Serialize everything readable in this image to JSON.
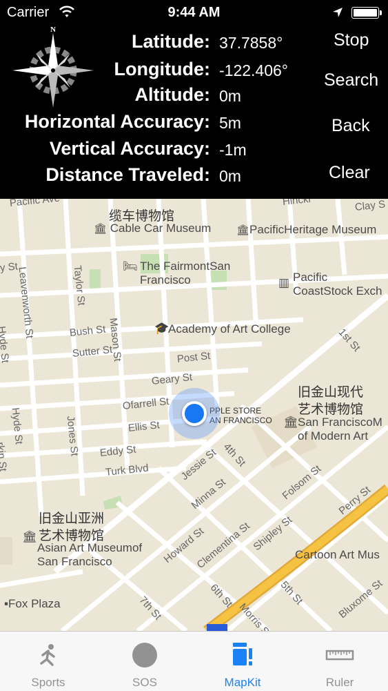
{
  "status_bar": {
    "carrier": "Carrier",
    "time": "9:44 AM"
  },
  "info": {
    "latitude_label": "Latitude:",
    "latitude_value": "37.7858°",
    "longitude_label": "Longitude:",
    "longitude_value": "-122.406°",
    "altitude_label": "Altitude:",
    "altitude_value": "0m",
    "horizontal_accuracy_label": "Horizontal Accuracy:",
    "horizontal_accuracy_value": "5m",
    "vertical_accuracy_label": "Vertical Accuracy:",
    "vertical_accuracy_value": "-1m",
    "distance_traveled_label": "Distance Traveled:",
    "distance_traveled_value": "0m"
  },
  "buttons": {
    "stop": "Stop",
    "search": "Search",
    "back": "Back",
    "clear": "Clear"
  },
  "compass": {
    "north": "N"
  },
  "map": {
    "pois": {
      "cable_car_cn": "缆车博物馆",
      "cable_car": "Cable Car Museum",
      "pacific_heritage": "PacificHeritage Museum",
      "fairmont_1": "The FairmontSan",
      "fairmont_2": "Francisco",
      "pacific_coast_1": "Pacific",
      "pacific_coast_2": "CoastStock Exch",
      "academy": "Academy of Art College",
      "sfmoma_cn_1": "旧金山现代",
      "sfmoma_cn_2": "艺术博物馆",
      "sfmoma_1": "San FranciscoM",
      "sfmoma_2": "of Modern Art",
      "apple_1": "PPLE STORE",
      "apple_2": "AN FRANCISCO",
      "asian_cn_1": "旧金山亚洲",
      "asian_cn_2": "艺术博物馆",
      "asian_1": "Asian Art Museumof",
      "asian_2": "San Francisco",
      "cartoon": "Cartoon Art Mus",
      "fox_plaza": "Fox Plaza"
    },
    "streets": {
      "pacific_ave": "Pacific Ave",
      "clay": "Clay S",
      "leavenworth": "Leavenworth St",
      "taylor": "Taylor St",
      "hyde_1": "Hyde St",
      "hyde_2": "Hyde St",
      "bush": "Bush St",
      "sutter": "Sutter St",
      "mason": "Mason St",
      "post": "Post St",
      "geary": "Geary St",
      "ofarrell": "Ofarrell St",
      "ellis": "Ellis St",
      "eddy": "Eddy St",
      "turk": "Turk Blvd",
      "jones": "Jones St",
      "jessie": "Jessie St",
      "fourth": "4th St",
      "first": "1st St",
      "minna": "Minna St",
      "folsom": "Folsom St",
      "howard": "Howard St",
      "clementina": "Clementina St",
      "shipley": "Shipley St",
      "perry": "Perry St",
      "fifth": "5th St",
      "sixth": "6th St",
      "seventh": "7th St",
      "morris": "Morris St",
      "bluxome": "Bluxome St",
      "larkin": "rkin St",
      "washington": "Hinckl",
      "fy": "y St"
    }
  },
  "tabs": [
    {
      "label": "Sports",
      "icon": "runner-icon",
      "active": false
    },
    {
      "label": "SOS",
      "icon": "circle-icon",
      "active": false
    },
    {
      "label": "MapKit",
      "icon": "map-icon",
      "active": true
    },
    {
      "label": "Ruler",
      "icon": "ruler-icon",
      "active": false
    }
  ],
  "colors": {
    "accent": "#1a82f7",
    "user_location": "#1877f2",
    "highway": "#f5c242",
    "park": "#c6e0b4"
  }
}
